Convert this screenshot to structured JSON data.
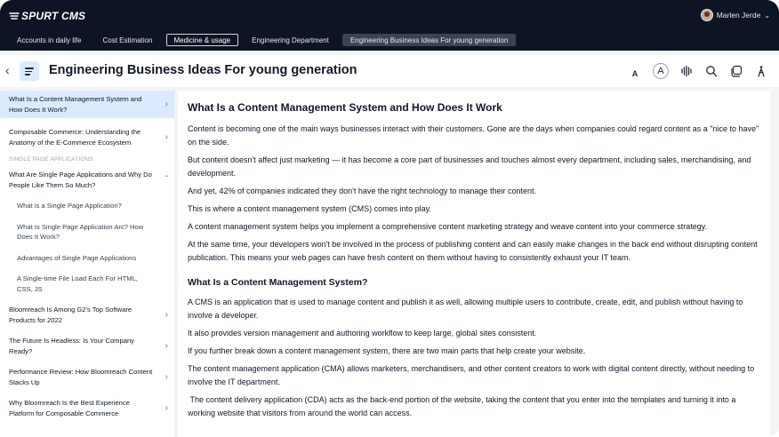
{
  "app": {
    "logo_text": "SPURT CMS"
  },
  "user": {
    "name": "Marlen Jerde"
  },
  "tabs": [
    {
      "label": "Accounts in daily life",
      "state": "normal"
    },
    {
      "label": "Cost Estimation",
      "state": "normal"
    },
    {
      "label": "Medicine & usage",
      "state": "outlined"
    },
    {
      "label": "Engineering Department",
      "state": "normal"
    },
    {
      "label": "Engineering Business Ideas For young generation",
      "state": "active"
    }
  ],
  "header": {
    "title": "Engineering Business Ideas For young generation"
  },
  "toolbar": {
    "font_small_label": "A",
    "font_large_label": "A"
  },
  "sidebar": {
    "items": [
      {
        "label": "What Is a Content Management System and How Does It Work?",
        "active": true,
        "arrow": "right"
      },
      {
        "label": "Composable Commerce: Understanding the Anatomy of the E-Commerce Ecosystem",
        "arrow": "right"
      },
      {
        "section": "SINGLE PAGE APPLICATIONS"
      },
      {
        "label": "What Are Single Page Applications and Why Do People Like Them So Much?",
        "arrow": "up"
      },
      {
        "label": "What is a Single Page Application?",
        "sub": true
      },
      {
        "label": "What Is Single Page Application Arc? How Does It Work?",
        "sub": true
      },
      {
        "label": "Advantages of Single Page Applications",
        "sub": true
      },
      {
        "label": "A Single-time File Load Each For HTML, CSS, JS",
        "sub": true
      },
      {
        "label": "Bloomreach Is Among G2's Top Software Products for 2022",
        "arrow": "right"
      },
      {
        "label": "The Future Is Headless: Is Your Company Ready?",
        "arrow": "right"
      },
      {
        "label": "Performance Review: How Bloomreach Content Stacks Up",
        "arrow": "right"
      },
      {
        "label": "Why Bloomreach Is the Best Experience Platform for Composable Commerce",
        "arrow": "right"
      }
    ]
  },
  "article": {
    "heading": "What Is a Content Management System and How Does It Work",
    "paragraphs_1": [
      "Content is becoming one of the main ways businesses interact with their customers. Gone are the days when companies could regard content as a \"nice to have\" on the side.",
      "But content doesn't affect just marketing — it has become a core part of businesses and touches almost every department, including sales, merchandising, and development.",
      "And yet, 42% of companies indicated they don't have the right technology to manage their content.",
      "This is where a content management system (CMS) comes into play.",
      "A content management system helps you implement a comprehensive content marketing strategy and weave content into your commerce strategy.",
      "At the same time, your developers won't be involved in the process of publishing content and can easily make changes in the back end without disrupting content publication. This means your web pages can have fresh content on them without having to consistently exhaust your IT team."
    ],
    "subheading": "What Is a Content Management System?",
    "paragraphs_2": [
      "A CMS is an application that is used to manage content and publish it as well, allowing multiple users to contribute, create, edit, and publish without having to involve a developer.",
      "It also provides version management and authoring workflow to keep large, global sites consistent.",
      "If you further break down a content management system, there are two main parts that help create your website.",
      "The content management application (CMA) allows marketers, merchandisers, and other content creators to work with digital content directly, without needing to involve the IT department.",
      " The content delivery application (CDA) acts as the back-end portion of the website, taking the content that you enter into the templates and turning it into a working website that visitors from around the world can access."
    ]
  }
}
